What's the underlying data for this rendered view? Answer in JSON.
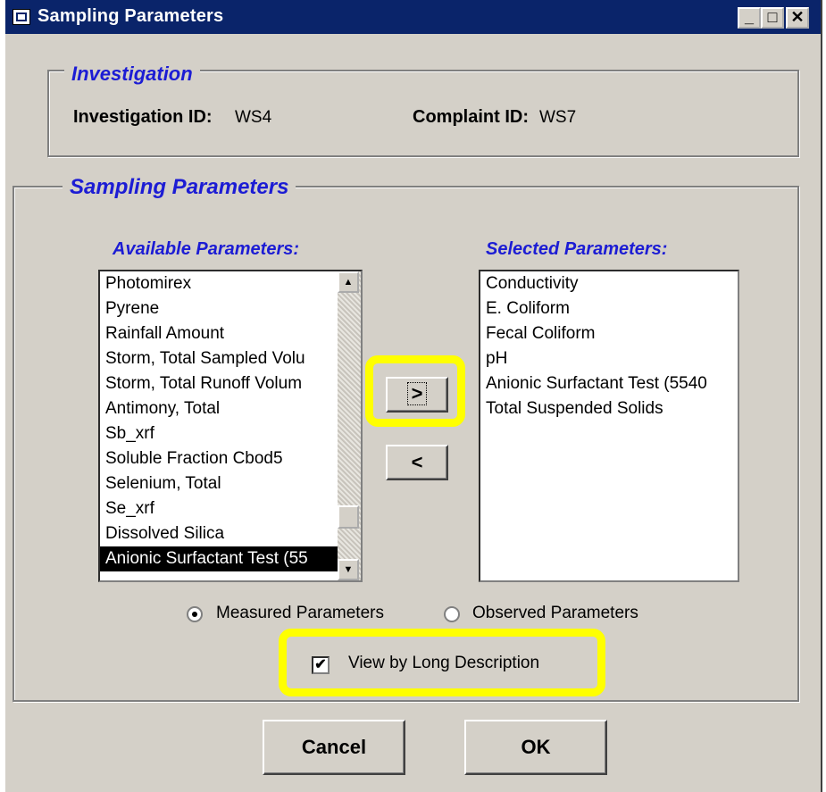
{
  "window": {
    "title": "Sampling Parameters"
  },
  "titlebar_buttons": {
    "minimize": "_",
    "maximize": "□",
    "close": "✕"
  },
  "investigation": {
    "legend": "Investigation",
    "investigation_id_label": "Investigation ID:",
    "investigation_id_value": "WS4",
    "complaint_id_label": "Complaint ID:",
    "complaint_id_value": "WS7"
  },
  "sampling": {
    "legend": "Sampling Parameters",
    "available_label": "Available Parameters:",
    "selected_label": "Selected Parameters:",
    "available_items": [
      "Photomirex",
      "Pyrene",
      "Rainfall Amount",
      "Storm, Total Sampled Volu",
      "Storm, Total Runoff Volum",
      "Antimony, Total",
      "Sb_xrf",
      "Soluble Fraction Cbod5",
      "Selenium, Total",
      "Se_xrf",
      "Dissolved Silica",
      "Anionic Surfactant Test (55"
    ],
    "available_selected_index": 11,
    "selected_items": [
      "Conductivity",
      "E. Coliform",
      "Fecal Coliform",
      "pH",
      "Anionic Surfactant Test (5540",
      "Total Suspended Solids"
    ],
    "add_button": ">",
    "remove_button": "<",
    "radio_measured": "Measured Parameters",
    "radio_observed": "Observed Parameters",
    "radio_selected": "measured",
    "checkbox_label": "View by Long Description",
    "checkbox_checked": true
  },
  "buttons": {
    "cancel": "Cancel",
    "ok": "OK"
  },
  "colors": {
    "titlebar": "#0a246a",
    "legend_text": "#1c1cd4",
    "highlight": "#ffff00",
    "dialog_bg": "#d4d0c8"
  }
}
